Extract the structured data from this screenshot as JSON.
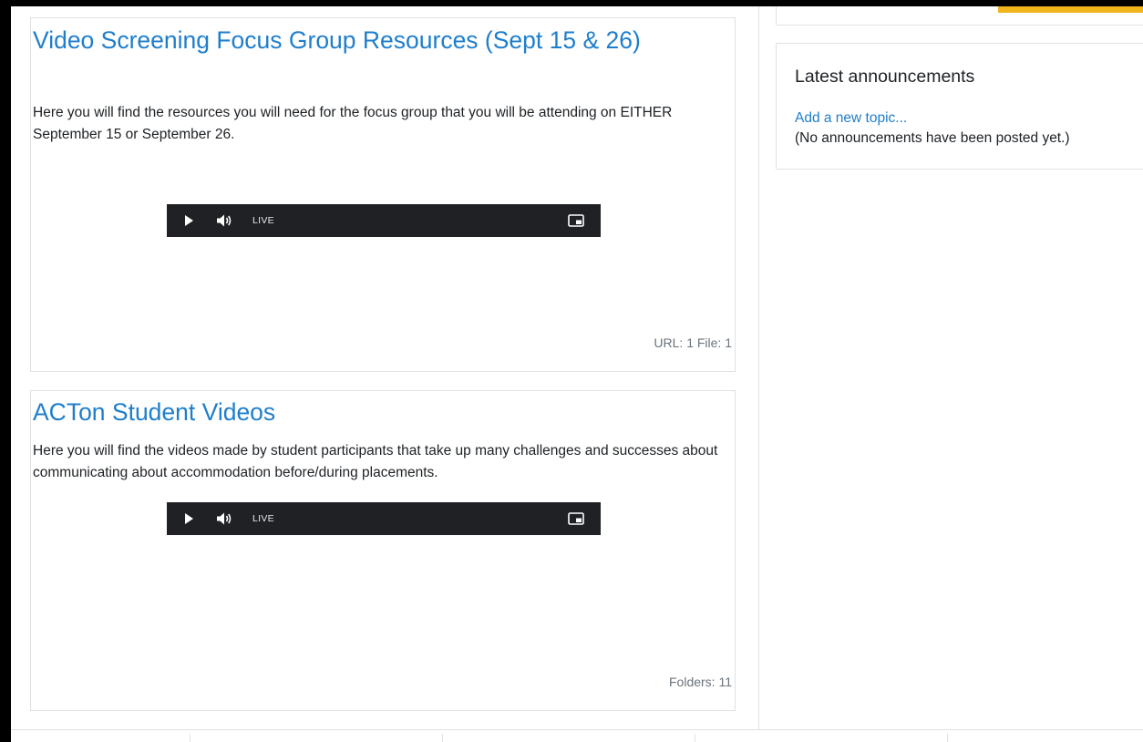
{
  "sections": [
    {
      "title": "Video Screening Focus Group Resources (Sept 15 & 26)",
      "description": "Here you will find the resources you will need for the focus group that you will be attending on EITHER September 15 or September 26.",
      "player": {
        "live_label": "LIVE"
      },
      "meta": "URL: 1 File: 1"
    },
    {
      "title": "ACTon Student Videos",
      "description": "Here you will find the videos made by student participants that take up many challenges and successes about communicating about accommodation before/during placements.",
      "player": {
        "live_label": "LIVE"
      },
      "meta": "Folders: 11"
    }
  ],
  "announcements": {
    "title": "Latest announcements",
    "add_link": "Add a new topic...",
    "empty_text": "(No announcements have been posted yet.)"
  },
  "icons": {
    "play": "play-icon",
    "volume": "volume-icon",
    "pip": "picture-in-picture-icon"
  },
  "colors": {
    "link": "#1f7ecb",
    "player_bg": "#1f2124",
    "accent": "#f0b41c",
    "border": "#dee2e6"
  }
}
